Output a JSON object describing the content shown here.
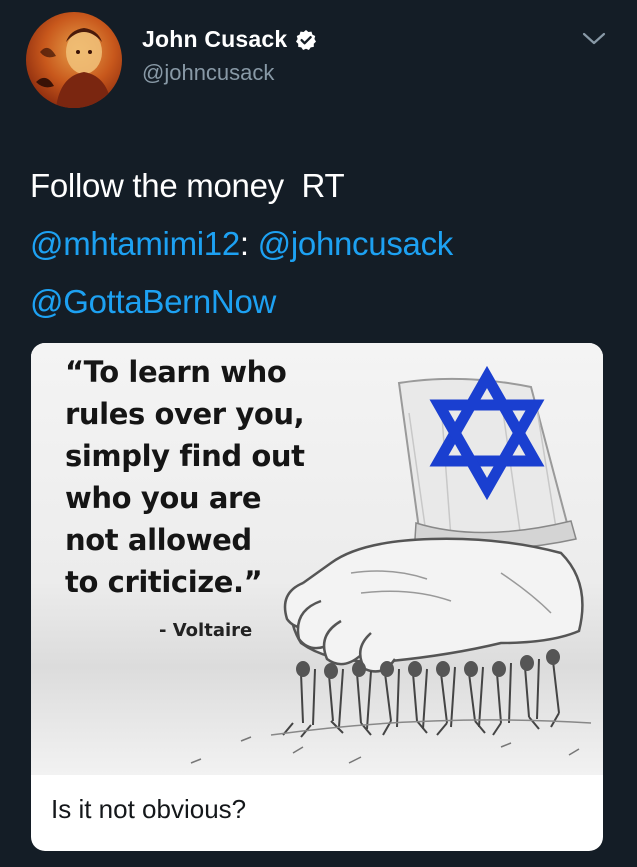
{
  "author": {
    "display_name": "John Cusack",
    "handle": "@johncusack",
    "verified": true
  },
  "tweet": {
    "lines": [
      [
        {
          "text": "Follow the money  RT",
          "type": "text"
        }
      ],
      [
        {
          "text": "@mhtamimi12",
          "type": "mention"
        },
        {
          "text": ": ",
          "type": "text"
        },
        {
          "text": "@johncusack",
          "type": "mention"
        }
      ],
      [
        {
          "text": "@GottaBernNow",
          "type": "mention"
        }
      ]
    ]
  },
  "media": {
    "quote_lines": [
      "“To learn who",
      "rules over you,",
      "simply find out",
      "who you are",
      "not allowed",
      "to criticize.”"
    ],
    "attribution": "- Voltaire",
    "caption": "Is it not obvious?"
  },
  "icons": {
    "verified": "verified-badge-icon",
    "menu": "chevron-down-icon",
    "star": "star-of-david-icon"
  },
  "colors": {
    "background": "#141d26",
    "mention": "#1da1f2",
    "handle": "#8899a6",
    "star": "#1a3fd0"
  }
}
